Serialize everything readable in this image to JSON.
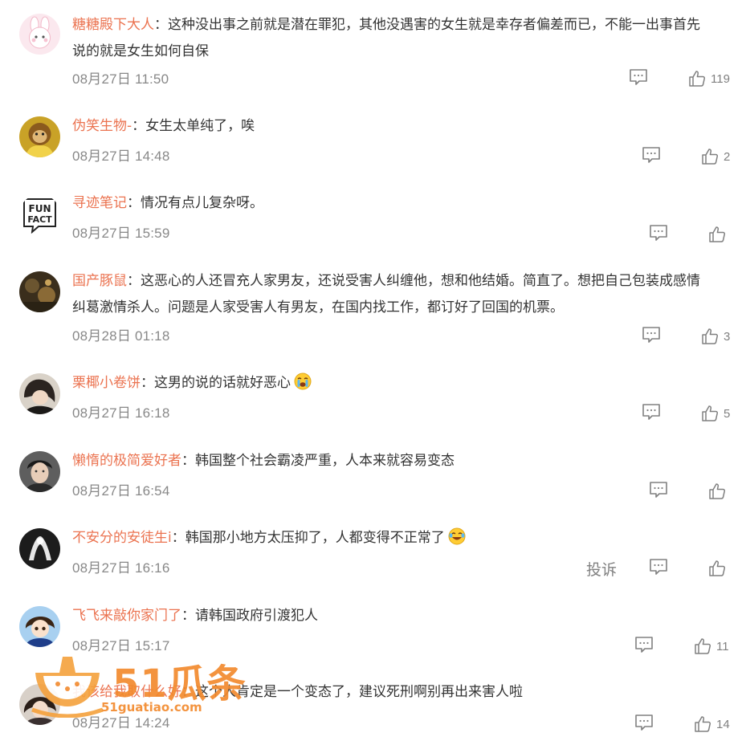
{
  "comments": [
    {
      "user": "糖糖殿下大人",
      "text_line1": "这种没出事之前就是潜在罪犯，其他没遇害的女生就是幸存者偏差而已，不能一出事首先",
      "text_line2": "说的就是女生如何自保",
      "date": "08月27日 11:50",
      "likes": "119",
      "avatar": "pink-bunny"
    },
    {
      "user": "伪笑生物-",
      "text_line1": "女生太单纯了，唉",
      "date": "08月27日 14:48",
      "likes": "2",
      "avatar": "yellow-monkey"
    },
    {
      "user": "寻迹笔记",
      "text_line1": "情况有点儿复杂呀。",
      "date": "08月27日 15:59",
      "likes": "",
      "avatar": "fun-fact",
      "avatar_text_top": "FUN",
      "avatar_text_bottom": "FACT"
    },
    {
      "user": "国产豚鼠",
      "text_line1": "这恶心的人还冒充人家男友，还说受害人纠缠他，想和他结婚。简直了。想把自己包装成感情",
      "text_line2": "纠葛激情杀人。问题是人家受害人有男友，在国内找工作，都订好了回国的机票。",
      "date": "08月28日 01:18",
      "likes": "3",
      "avatar": "dark-photo"
    },
    {
      "user": "栗椰小卷饼",
      "text_line1": "这男的说的话就好恶心",
      "emoji": "crying-face",
      "date": "08月27日 16:18",
      "likes": "5",
      "avatar": "girl-photo"
    },
    {
      "user": "懒惰的极简爱好者",
      "text_line1": "韩国整个社会霸凌严重，人本来就容易变态",
      "date": "08月27日 16:54",
      "likes": "",
      "avatar": "man-photo"
    },
    {
      "user": "不安分的安徒生i",
      "text_line1": "韩国那小地方太压抑了，人都变得不正常了",
      "emoji": "laugh-cry-face",
      "date": "08月27日 16:16",
      "likes": "",
      "report": "投诉",
      "avatar": "dark-art"
    },
    {
      "user": "飞飞来敲你家门了",
      "text_line1": "请韩国政府引渡犯人",
      "date": "08月27日 15:17",
      "likes": "11",
      "avatar": "anime-boy"
    },
    {
      "user": "我该给我取什么好",
      "text_line1": "这个人肯定是一个变态了，建议死刑啊别再出来害人啦",
      "date": "08月27日 14:24",
      "likes": "14",
      "avatar": "girl2-photo"
    }
  ],
  "watermark": {
    "brand": "51瓜条",
    "domain": "51guatiao.com"
  },
  "colors": {
    "username": "#eb7350",
    "body_text": "#333333",
    "meta": "#888888",
    "watermark": "#f28a2e"
  },
  "icons": {
    "reply": "comment-bubble-icon",
    "like": "thumbs-up-icon"
  }
}
